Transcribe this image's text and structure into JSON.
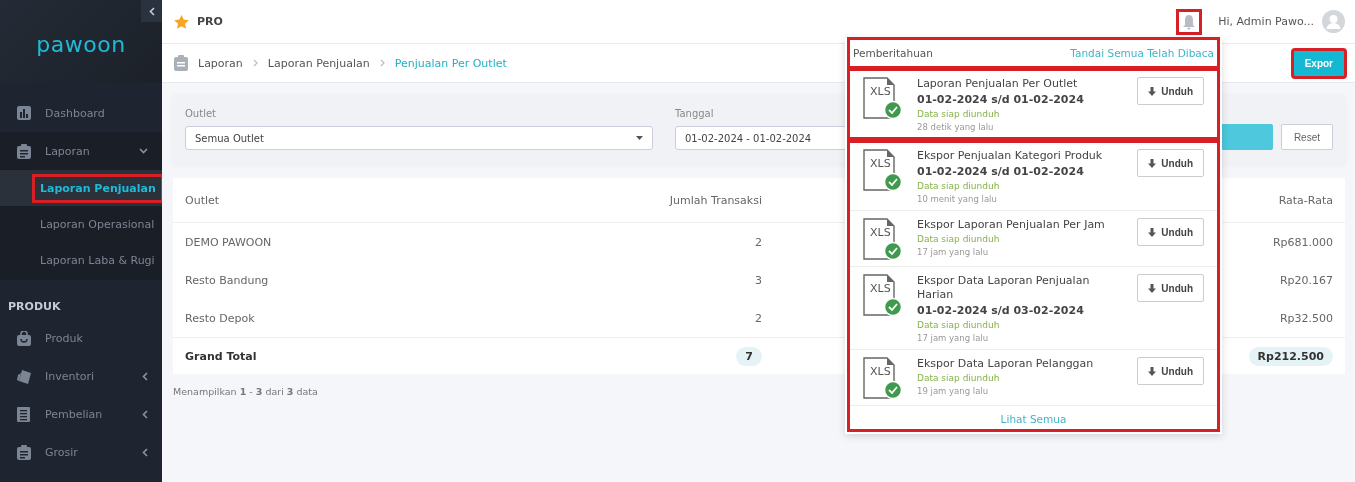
{
  "sidebar": {
    "logo": "pawoon",
    "items": [
      {
        "kind": "item",
        "label": "Dashboard",
        "has_children": false
      },
      {
        "kind": "item",
        "label": "Laporan",
        "expanded": true,
        "has_children": true,
        "children": [
          {
            "label": "Laporan Penjualan",
            "selected": true,
            "highlighted": true
          },
          {
            "label": "Laporan Operasional",
            "selected": false,
            "highlighted": false
          },
          {
            "label": "Laporan Laba & Rugi",
            "selected": false,
            "highlighted": false
          }
        ]
      },
      {
        "kind": "section",
        "label": "PRODUK"
      },
      {
        "kind": "item",
        "label": "Produk",
        "has_children": false
      },
      {
        "kind": "item",
        "label": "Inventori",
        "expanded": false,
        "has_children": true
      },
      {
        "kind": "item",
        "label": "Pembelian",
        "expanded": false,
        "has_children": true
      },
      {
        "kind": "item",
        "label": "Grosir",
        "expanded": false,
        "has_children": true
      }
    ]
  },
  "topbar": {
    "plan": "PRO",
    "user": "Hi, Admin Pawo...",
    "bell_highlighted": true
  },
  "breadcrumb": [
    {
      "label": "Laporan",
      "current": false
    },
    {
      "label": "Laporan Penjualan",
      "current": false
    },
    {
      "label": "Penjualan Per Outlet",
      "current": true
    }
  ],
  "export_button": {
    "label": "Expor",
    "highlighted": true
  },
  "filters": {
    "outlet": {
      "label": "Outlet",
      "value": "Semua Outlet"
    },
    "date": {
      "label": "Tanggal",
      "value": "01-02-2024 - 01-02-2024"
    },
    "reset": "Reset"
  },
  "table": {
    "columns": [
      "Outlet",
      "Jumlah Transaksi",
      "Rata-Rata"
    ],
    "rows": [
      [
        "DEMO PAWOON",
        "2",
        "Rp681.000"
      ],
      [
        "Resto Bandung",
        "3",
        "Rp20.167"
      ],
      [
        "Resto Depok",
        "2",
        "Rp32.500"
      ]
    ],
    "total": [
      "Grand Total",
      "7",
      "Rp212.500"
    ]
  },
  "footer": "Menampilkan **1** - **3** dari **3** data",
  "notifications": {
    "title": "Pemberitahuan",
    "mark_all": "Tandai Semua Telah Dibaca",
    "header_highlighted": true,
    "others_highlighted": true,
    "see_all": "Lihat Semua",
    "items": [
      {
        "file": "XLS",
        "title": "Laporan Penjualan Per Outlet",
        "period": "01-02-2024 s/d 01-02-2024",
        "status": "Data siap diunduh",
        "time": "28 detik yang lalu",
        "button": "Unduh",
        "highlighted": true
      },
      {
        "file": "XLS",
        "title": "Ekspor Penjualan Kategori Produk",
        "period": "01-02-2024 s/d 01-02-2024",
        "status": "Data siap diunduh",
        "time": "10 menit yang lalu",
        "button": "Unduh",
        "highlighted": false
      },
      {
        "file": "XLS",
        "title": "Ekspor Laporan Penjualan Per Jam",
        "status": "Data siap diunduh",
        "time": "17 jam yang lalu",
        "button": "Unduh",
        "highlighted": false
      },
      {
        "file": "XLS",
        "title": "Ekspor Data Laporan Penjualan Harian",
        "period": "01-02-2024 s/d 03-02-2024",
        "status": "Data siap diunduh",
        "time": "17 jam yang lalu",
        "button": "Unduh",
        "highlighted": false
      },
      {
        "file": "XLS",
        "title": "Ekspor Data Laporan Pelanggan",
        "status": "Data siap diunduh",
        "time": "19 jam yang lalu",
        "button": "Unduh",
        "highlighted": false
      }
    ]
  }
}
